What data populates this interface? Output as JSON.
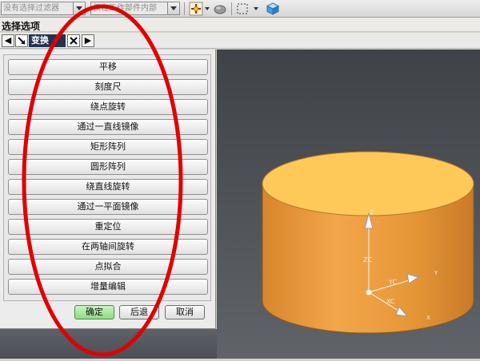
{
  "toolbar": {
    "filter_combo": "没有选择过滤器",
    "scope_combo": "仅在工作部件内部",
    "icons": [
      "snap-point-icon",
      "view-orient-icon",
      "select-box-icon",
      "cube-view-icon"
    ]
  },
  "title_strip": {
    "title": "选择选项"
  },
  "tabs": {
    "active_label": "变换"
  },
  "options": [
    {
      "label": "平移"
    },
    {
      "label": "刻度尺"
    },
    {
      "label": "绕点旋转"
    },
    {
      "label": "通过一直线镜像"
    },
    {
      "label": "矩形阵列"
    },
    {
      "label": "圆形阵列"
    },
    {
      "label": "绕直线旋转"
    },
    {
      "label": "通过一平面镜像"
    },
    {
      "label": "重定位"
    },
    {
      "label": "在两轴间旋转"
    },
    {
      "label": "点拟合"
    },
    {
      "label": "增量编辑"
    }
  ],
  "actions": {
    "ok": "确定",
    "back": "后退",
    "cancel": "取消"
  },
  "viewport": {
    "axis_labels": {
      "z": "ZC",
      "y": "YC",
      "x": "XC",
      "z_small": "Z",
      "y_small": "Y",
      "x_small": "X"
    },
    "colors": {
      "cylinder_top": "#ffc95a",
      "cylinder_side": "#f0a040",
      "annotation": "#e00000"
    }
  }
}
